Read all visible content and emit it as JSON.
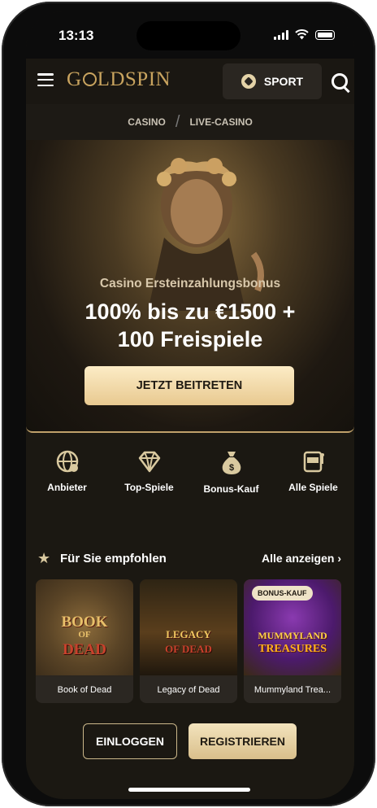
{
  "status": {
    "time": "13:13"
  },
  "header": {
    "logo": "GOLDSPIN",
    "sport_label": "SPORT"
  },
  "breadcrumb": {
    "items": [
      "CASINO",
      "LIVE-CASINO"
    ],
    "separator": "/"
  },
  "hero": {
    "subtitle": "Casino Ersteinzahlungsbonus",
    "title_line1": "100% bis zu €1500 +",
    "title_line2": "100 Freispiele",
    "cta": "JETZT BEITRETEN"
  },
  "categories": [
    {
      "label": "Anbieter",
      "icon": "globe-icon"
    },
    {
      "label": "Top-Spiele",
      "icon": "diamond-icon"
    },
    {
      "label": "Bonus-Kauf",
      "icon": "money-bag-icon"
    },
    {
      "label": "Alle Spiele",
      "icon": "slot-machine-icon"
    }
  ],
  "recommended": {
    "title": "Für Sie empfohlen",
    "show_all": "Alle anzeigen",
    "games": [
      {
        "name": "Book of Dead",
        "art_line1": "BOOK",
        "art_line2": "OF",
        "art_line3": "DEAD",
        "badge": ""
      },
      {
        "name": "Legacy of Dead",
        "art_line1": "LEGACY",
        "art_line2": "OF DEAD",
        "art_line3": "",
        "badge": ""
      },
      {
        "name": "Mummyland Trea...",
        "art_line1": "MUMMYLAND",
        "art_line2": "TREASURES",
        "art_line3": "",
        "badge": "BONUS-KAUF"
      }
    ]
  },
  "auth": {
    "login": "EINLOGGEN",
    "register": "REGISTRIEREN"
  },
  "colors": {
    "gold": "#c9a45f",
    "background": "#1b1812",
    "cta_light": "#fcecc6"
  }
}
